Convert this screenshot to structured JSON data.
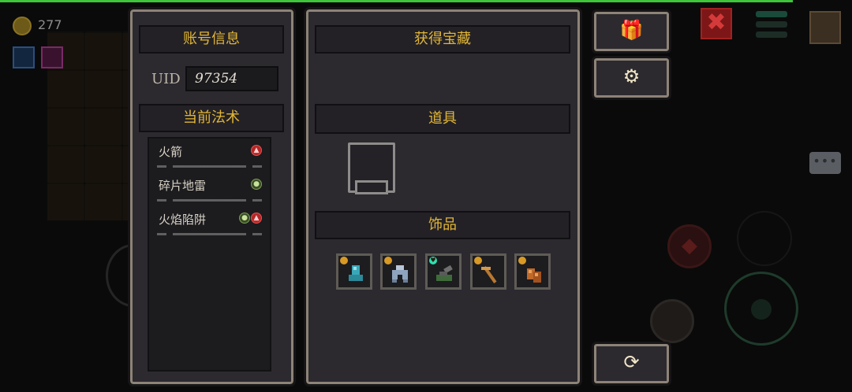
{
  "hud": {
    "coins": "277",
    "close_glyph": "✖",
    "chat_glyph": "•••"
  },
  "account": {
    "title": "账号信息",
    "uid_label": "UID",
    "uid_value": "97354"
  },
  "spells": {
    "title": "当前法术",
    "items": [
      {
        "name": "火箭",
        "elements": [
          "fire"
        ]
      },
      {
        "name": "碎片地雷",
        "elements": [
          "earth"
        ]
      },
      {
        "name": "火焰陷阱",
        "elements": [
          "earth",
          "fire"
        ]
      }
    ]
  },
  "treasure": {
    "title": "获得宝藏",
    "props_title": "道具",
    "accessories_title": "饰品",
    "accessories": [
      {
        "icon": "boot-icon",
        "badge": "gold"
      },
      {
        "icon": "armor-icon",
        "badge": "gold"
      },
      {
        "icon": "cannon-icon",
        "badge": "teal"
      },
      {
        "icon": "pickaxe-icon",
        "badge": "gold"
      },
      {
        "icon": "gloves-icon",
        "badge": "gold"
      }
    ]
  },
  "side_buttons": {
    "gift_glyph": "🎁",
    "settings_glyph": "⚙",
    "refresh_glyph": "⟳"
  },
  "colors": {
    "accent_gold": "#e2b637",
    "panel_bg": "#2c2a2f",
    "panel_border": "#8d8377",
    "health_green": "#3fc53a",
    "fire_red": "#b42727"
  }
}
